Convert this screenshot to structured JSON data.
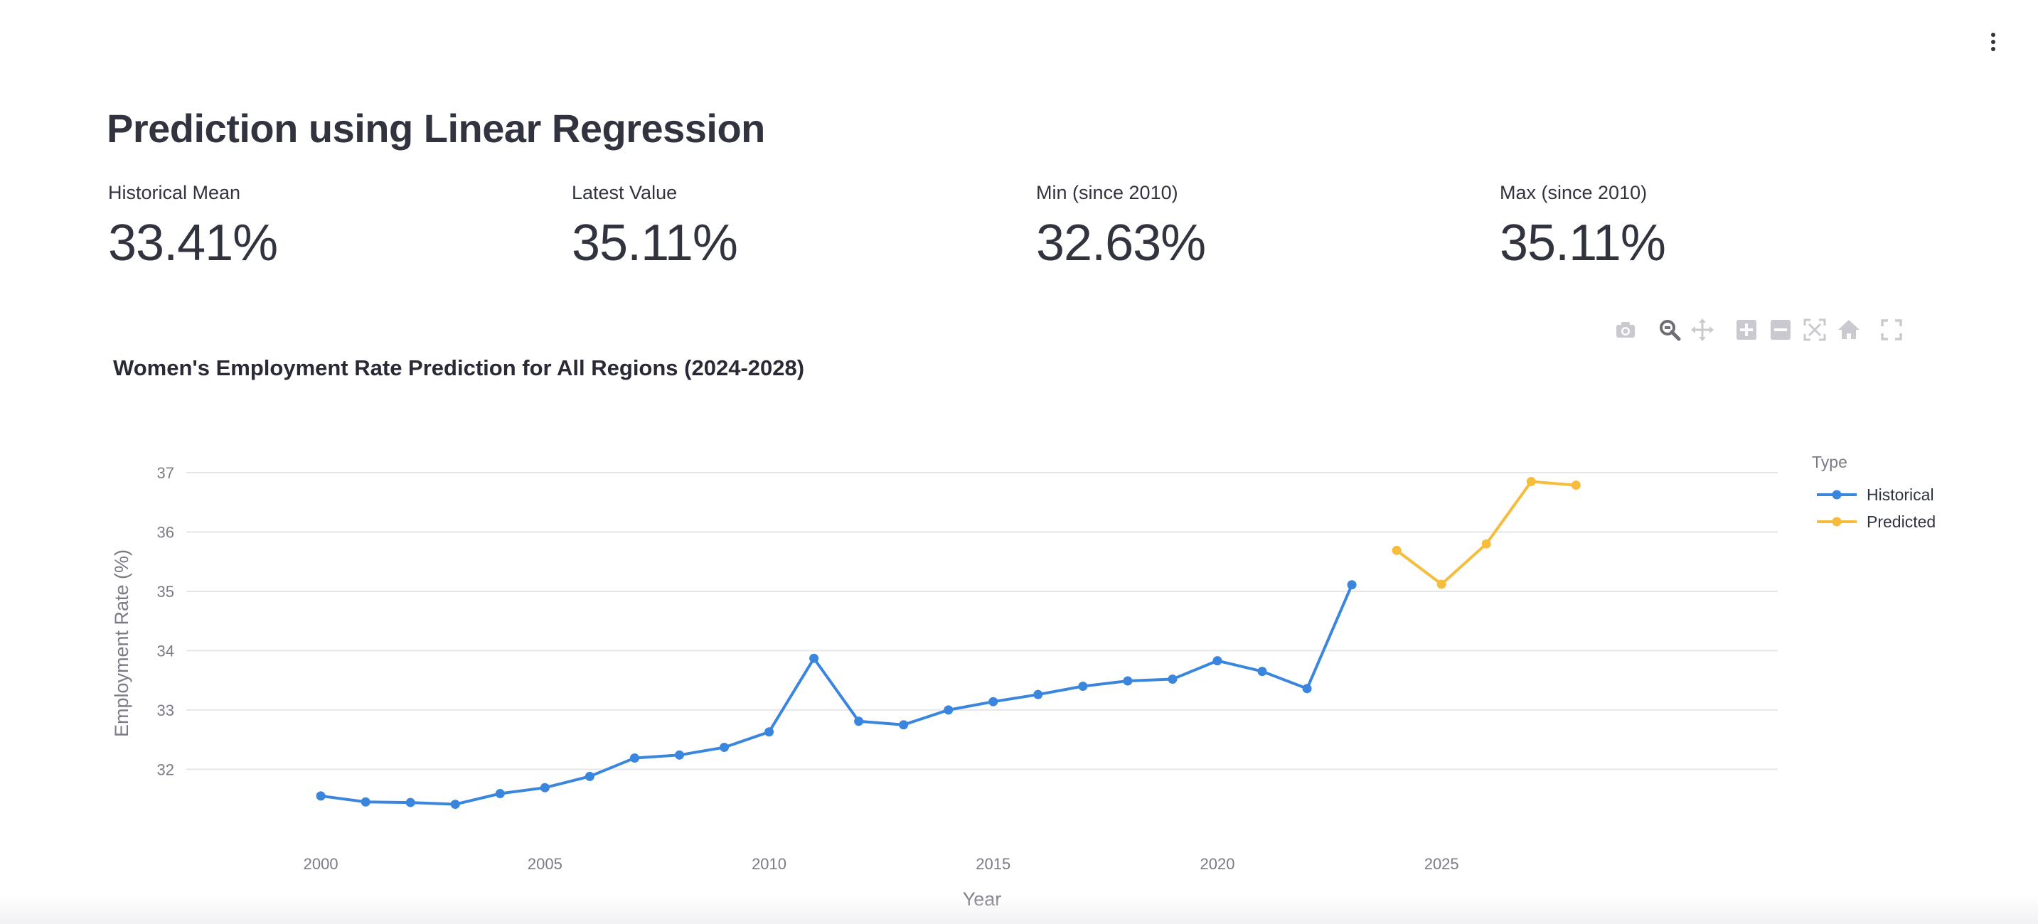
{
  "page": {
    "title": "Prediction using Linear Regression"
  },
  "metrics": [
    {
      "label": "Historical Mean",
      "value": "33.41%"
    },
    {
      "label": "Latest Value",
      "value": "35.11%"
    },
    {
      "label": "Min (since 2010)",
      "value": "32.63%"
    },
    {
      "label": "Max (since 2010)",
      "value": "35.11%"
    }
  ],
  "modebar": [
    "camera-icon",
    "zoom-icon",
    "pan-icon",
    "zoom-in-icon",
    "zoom-out-icon",
    "autoscale-icon",
    "home-icon",
    "fullscreen-icon"
  ],
  "chart_data": {
    "type": "line",
    "title": "Women's Employment Rate Prediction for All Regions (2024-2028)",
    "xlabel": "Year",
    "ylabel": "Employment Rate (%)",
    "xlim": [
      1997,
      2032.5
    ],
    "ylim": [
      30.65,
      37.3
    ],
    "x_ticks": [
      2000,
      2005,
      2010,
      2015,
      2020,
      2025
    ],
    "y_ticks": [
      32,
      33,
      34,
      35,
      36,
      37
    ],
    "grid": "horizontal",
    "legend": {
      "title": "Type",
      "position": "right"
    },
    "series": [
      {
        "name": "Historical",
        "color": "#3a86df",
        "x": [
          2000,
          2001,
          2002,
          2003,
          2004,
          2005,
          2006,
          2007,
          2008,
          2009,
          2010,
          2011,
          2012,
          2013,
          2014,
          2015,
          2016,
          2017,
          2018,
          2019,
          2020,
          2021,
          2022,
          2023
        ],
        "y": [
          31.55,
          31.45,
          31.44,
          31.41,
          31.59,
          31.69,
          31.88,
          32.19,
          32.24,
          32.37,
          32.63,
          33.87,
          32.81,
          32.75,
          33.0,
          33.14,
          33.26,
          33.4,
          33.49,
          33.52,
          33.83,
          33.65,
          33.36,
          35.11
        ]
      },
      {
        "name": "Predicted",
        "color": "#f6bd3c",
        "x": [
          2024,
          2025,
          2026,
          2027,
          2028
        ],
        "y": [
          35.69,
          35.12,
          35.8,
          36.85,
          36.79
        ]
      }
    ]
  }
}
